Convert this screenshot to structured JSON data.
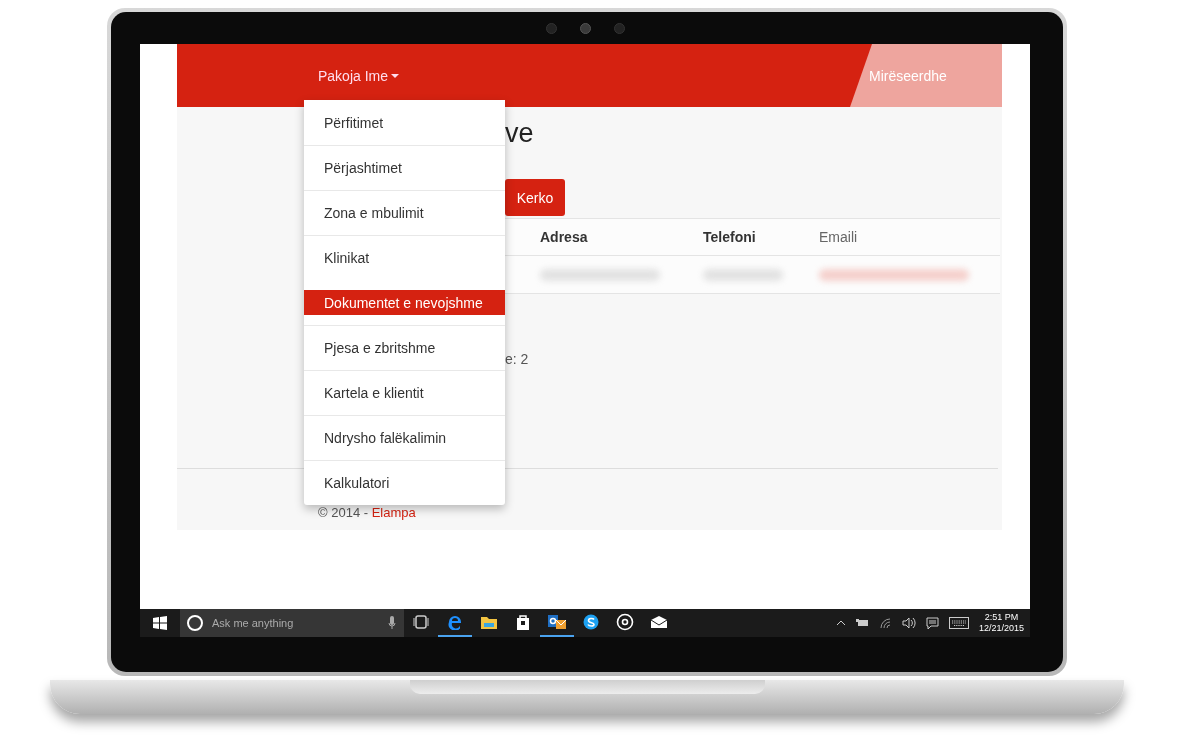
{
  "navbar": {
    "menu_label": "Pakoja Ime",
    "greeting": "Mirëseerdhe"
  },
  "dropdown": {
    "items": [
      {
        "label": "Përfitimet",
        "selected": false
      },
      {
        "label": "Përjashtimet",
        "selected": false
      },
      {
        "label": "Zona e mbulimit",
        "selected": false
      },
      {
        "label": "Klinikat",
        "selected": false
      },
      {
        "label": "Dokumentet e nevojshme",
        "selected": true
      },
      {
        "label": "Pjesa e zbritshme",
        "selected": false
      },
      {
        "label": "Kartela e klientit",
        "selected": false
      },
      {
        "label": "Ndrysho falëkalimin",
        "selected": false
      },
      {
        "label": "Kalkulatori",
        "selected": false
      }
    ]
  },
  "page": {
    "title": "ve",
    "search_button": "Kerko",
    "table": {
      "columns": [
        "Adresa",
        "Telefoni",
        "Emaili"
      ]
    },
    "count": "e: 2",
    "footer_prefix": "© 2014 - ",
    "footer_link": "Elampa"
  },
  "taskbar": {
    "search_placeholder": "Ask me anything",
    "apps": [
      {
        "kind": "taskview",
        "running": false
      },
      {
        "kind": "edge",
        "running": true
      },
      {
        "kind": "explorer",
        "running": false
      },
      {
        "kind": "store",
        "running": false
      },
      {
        "kind": "outlook",
        "running": true
      },
      {
        "kind": "skype",
        "running": false
      },
      {
        "kind": "groove",
        "running": false
      },
      {
        "kind": "mail",
        "running": false
      }
    ],
    "time": "2:51 PM",
    "date": "12/21/2015"
  }
}
